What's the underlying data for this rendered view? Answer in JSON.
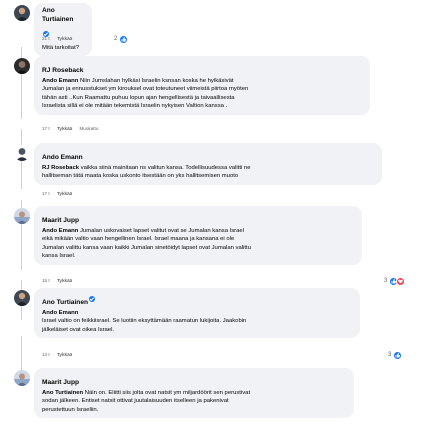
{
  "comments": [
    {
      "author": "Ano Turtiainen",
      "verified": true,
      "lines": [
        "Mitä tarkoitat?"
      ],
      "time": "21 t",
      "like": "Tykkää",
      "extra": "",
      "reaction_count": "2"
    },
    {
      "author": "RJ Roseback",
      "verified": false,
      "mention": "Ando Emann",
      "lines": [
        "Niin Jumslahan hylkäsi Israelin ksnsan koska he hylkäsivät",
        "Jumalan ja ennusstukset ym kirouksel ovat toteutuneet viimeistä piirtoa myöten",
        "tähän asti ..Kun Raamattu puhuu lopun ajan hengellisestä ja taivaallisesta",
        "Israelista sillä ei ole mitään tekemistä Israelin nykyisen Valtion kanssa ."
      ],
      "time": "17 t",
      "like": "Tykkää",
      "extra": "Muokattu",
      "reaction_count": ""
    },
    {
      "author": "Ando Emann",
      "verified": false,
      "mention": "RJ Roseback",
      "lines": [
        "vaikka siinä mainitaan ns valitun kansa. Todellisuudessa valitti ne",
        "hallitseman tätä maata koska uskonto itsestään on yks hallitsemisen muoto"
      ],
      "time": "17 t",
      "like": "Tykkää",
      "extra": "",
      "reaction_count": ""
    },
    {
      "author": "Maarit Jupp",
      "verified": false,
      "mention": "Ando Emann",
      "lines": [
        "Jumalan uskovaiset lapset valitut ovat se Jumalan kansa Israel",
        "eikä mikään valtio vaan hengellinen Israel. Israel maana ja kansana ei ole",
        "Jumalan valittu kansa vaan kaikki Jumalan sinetöidyt lapset ovat Jumalan valittu",
        "kansa Israel."
      ],
      "time": "15 t",
      "like": "Tykkää",
      "extra": "",
      "reaction_count": "3"
    },
    {
      "author": "Ano Turtiainen",
      "verified": true,
      "mention": "Ando Emann",
      "lines": [
        "Israel valtio on feikkiisrael. Se luotiin eksyttämään raamatun lukijoita. Jaakobin",
        "jälkeläiset ovat oikea Israel."
      ],
      "time": "13 t",
      "like": "Tykkää",
      "extra": "",
      "reaction_count": "3"
    },
    {
      "author": "Maarit Jupp",
      "verified": false,
      "mention": "Ano Turtiainen",
      "lines": [
        "Näin on. Eliitti siis jolta ovat natsit ym miljardöörit sen perustivat",
        "sodan jälkeen. Entiset natsit ottivat juutalaisuuden itselleen ja pakenivat",
        "perustettuun Israeliin."
      ],
      "time": "",
      "like": "",
      "extra": "",
      "reaction_count": ""
    }
  ],
  "colors": {
    "bubble": "#f0f2f5",
    "meta_text": "#65676b",
    "verified": "#1877f2",
    "like_reaction": "#1877f2",
    "love_reaction": "#f33e58"
  },
  "icons": {
    "verified": "verified-badge-icon",
    "like": "thumbs-up-icon",
    "love": "heart-icon"
  }
}
